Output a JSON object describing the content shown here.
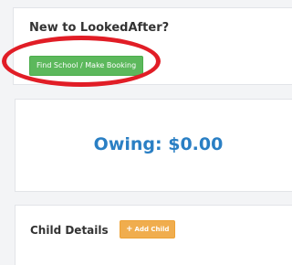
{
  "new_section": {
    "title": "New to LookedAfter?",
    "button_label": "Find School / Make Booking"
  },
  "owing": {
    "text": "Owing: $0.00"
  },
  "child_section": {
    "title": "Child Details",
    "add_icon": "+",
    "add_label": "Add Child"
  },
  "colors": {
    "find_button": "#5cb85c",
    "owing_text": "#2a7fc4",
    "add_button": "#f0ad4e",
    "highlight": "#e11d26"
  }
}
